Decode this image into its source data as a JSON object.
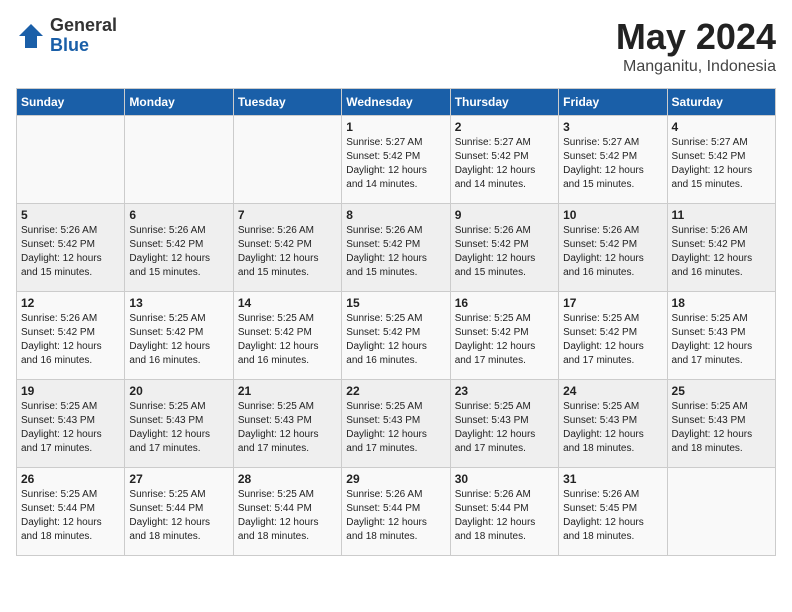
{
  "logo": {
    "general": "General",
    "blue": "Blue"
  },
  "title": "May 2024",
  "location": "Manganitu, Indonesia",
  "headers": [
    "Sunday",
    "Monday",
    "Tuesday",
    "Wednesday",
    "Thursday",
    "Friday",
    "Saturday"
  ],
  "weeks": [
    [
      {
        "day": "",
        "sunrise": "",
        "sunset": "",
        "daylight": ""
      },
      {
        "day": "",
        "sunrise": "",
        "sunset": "",
        "daylight": ""
      },
      {
        "day": "",
        "sunrise": "",
        "sunset": "",
        "daylight": ""
      },
      {
        "day": "1",
        "sunrise": "Sunrise: 5:27 AM",
        "sunset": "Sunset: 5:42 PM",
        "daylight": "Daylight: 12 hours and 14 minutes."
      },
      {
        "day": "2",
        "sunrise": "Sunrise: 5:27 AM",
        "sunset": "Sunset: 5:42 PM",
        "daylight": "Daylight: 12 hours and 14 minutes."
      },
      {
        "day": "3",
        "sunrise": "Sunrise: 5:27 AM",
        "sunset": "Sunset: 5:42 PM",
        "daylight": "Daylight: 12 hours and 15 minutes."
      },
      {
        "day": "4",
        "sunrise": "Sunrise: 5:27 AM",
        "sunset": "Sunset: 5:42 PM",
        "daylight": "Daylight: 12 hours and 15 minutes."
      }
    ],
    [
      {
        "day": "5",
        "sunrise": "Sunrise: 5:26 AM",
        "sunset": "Sunset: 5:42 PM",
        "daylight": "Daylight: 12 hours and 15 minutes."
      },
      {
        "day": "6",
        "sunrise": "Sunrise: 5:26 AM",
        "sunset": "Sunset: 5:42 PM",
        "daylight": "Daylight: 12 hours and 15 minutes."
      },
      {
        "day": "7",
        "sunrise": "Sunrise: 5:26 AM",
        "sunset": "Sunset: 5:42 PM",
        "daylight": "Daylight: 12 hours and 15 minutes."
      },
      {
        "day": "8",
        "sunrise": "Sunrise: 5:26 AM",
        "sunset": "Sunset: 5:42 PM",
        "daylight": "Daylight: 12 hours and 15 minutes."
      },
      {
        "day": "9",
        "sunrise": "Sunrise: 5:26 AM",
        "sunset": "Sunset: 5:42 PM",
        "daylight": "Daylight: 12 hours and 15 minutes."
      },
      {
        "day": "10",
        "sunrise": "Sunrise: 5:26 AM",
        "sunset": "Sunset: 5:42 PM",
        "daylight": "Daylight: 12 hours and 16 minutes."
      },
      {
        "day": "11",
        "sunrise": "Sunrise: 5:26 AM",
        "sunset": "Sunset: 5:42 PM",
        "daylight": "Daylight: 12 hours and 16 minutes."
      }
    ],
    [
      {
        "day": "12",
        "sunrise": "Sunrise: 5:26 AM",
        "sunset": "Sunset: 5:42 PM",
        "daylight": "Daylight: 12 hours and 16 minutes."
      },
      {
        "day": "13",
        "sunrise": "Sunrise: 5:25 AM",
        "sunset": "Sunset: 5:42 PM",
        "daylight": "Daylight: 12 hours and 16 minutes."
      },
      {
        "day": "14",
        "sunrise": "Sunrise: 5:25 AM",
        "sunset": "Sunset: 5:42 PM",
        "daylight": "Daylight: 12 hours and 16 minutes."
      },
      {
        "day": "15",
        "sunrise": "Sunrise: 5:25 AM",
        "sunset": "Sunset: 5:42 PM",
        "daylight": "Daylight: 12 hours and 16 minutes."
      },
      {
        "day": "16",
        "sunrise": "Sunrise: 5:25 AM",
        "sunset": "Sunset: 5:42 PM",
        "daylight": "Daylight: 12 hours and 17 minutes."
      },
      {
        "day": "17",
        "sunrise": "Sunrise: 5:25 AM",
        "sunset": "Sunset: 5:42 PM",
        "daylight": "Daylight: 12 hours and 17 minutes."
      },
      {
        "day": "18",
        "sunrise": "Sunrise: 5:25 AM",
        "sunset": "Sunset: 5:43 PM",
        "daylight": "Daylight: 12 hours and 17 minutes."
      }
    ],
    [
      {
        "day": "19",
        "sunrise": "Sunrise: 5:25 AM",
        "sunset": "Sunset: 5:43 PM",
        "daylight": "Daylight: 12 hours and 17 minutes."
      },
      {
        "day": "20",
        "sunrise": "Sunrise: 5:25 AM",
        "sunset": "Sunset: 5:43 PM",
        "daylight": "Daylight: 12 hours and 17 minutes."
      },
      {
        "day": "21",
        "sunrise": "Sunrise: 5:25 AM",
        "sunset": "Sunset: 5:43 PM",
        "daylight": "Daylight: 12 hours and 17 minutes."
      },
      {
        "day": "22",
        "sunrise": "Sunrise: 5:25 AM",
        "sunset": "Sunset: 5:43 PM",
        "daylight": "Daylight: 12 hours and 17 minutes."
      },
      {
        "day": "23",
        "sunrise": "Sunrise: 5:25 AM",
        "sunset": "Sunset: 5:43 PM",
        "daylight": "Daylight: 12 hours and 17 minutes."
      },
      {
        "day": "24",
        "sunrise": "Sunrise: 5:25 AM",
        "sunset": "Sunset: 5:43 PM",
        "daylight": "Daylight: 12 hours and 18 minutes."
      },
      {
        "day": "25",
        "sunrise": "Sunrise: 5:25 AM",
        "sunset": "Sunset: 5:43 PM",
        "daylight": "Daylight: 12 hours and 18 minutes."
      }
    ],
    [
      {
        "day": "26",
        "sunrise": "Sunrise: 5:25 AM",
        "sunset": "Sunset: 5:44 PM",
        "daylight": "Daylight: 12 hours and 18 minutes."
      },
      {
        "day": "27",
        "sunrise": "Sunrise: 5:25 AM",
        "sunset": "Sunset: 5:44 PM",
        "daylight": "Daylight: 12 hours and 18 minutes."
      },
      {
        "day": "28",
        "sunrise": "Sunrise: 5:25 AM",
        "sunset": "Sunset: 5:44 PM",
        "daylight": "Daylight: 12 hours and 18 minutes."
      },
      {
        "day": "29",
        "sunrise": "Sunrise: 5:26 AM",
        "sunset": "Sunset: 5:44 PM",
        "daylight": "Daylight: 12 hours and 18 minutes."
      },
      {
        "day": "30",
        "sunrise": "Sunrise: 5:26 AM",
        "sunset": "Sunset: 5:44 PM",
        "daylight": "Daylight: 12 hours and 18 minutes."
      },
      {
        "day": "31",
        "sunrise": "Sunrise: 5:26 AM",
        "sunset": "Sunset: 5:45 PM",
        "daylight": "Daylight: 12 hours and 18 minutes."
      },
      {
        "day": "",
        "sunrise": "",
        "sunset": "",
        "daylight": ""
      }
    ]
  ]
}
